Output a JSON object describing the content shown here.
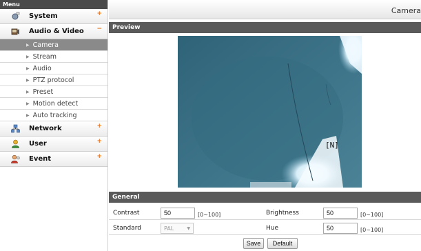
{
  "sidebar": {
    "header": "Menu",
    "sections": [
      {
        "label": "System",
        "mark": "+",
        "icon": "system-icon"
      },
      {
        "label": "Audio & Video",
        "mark": "−",
        "icon": "audio-video-icon"
      }
    ],
    "subitems": [
      {
        "label": "Camera"
      },
      {
        "label": "Stream"
      },
      {
        "label": "Audio"
      },
      {
        "label": "PTZ protocol"
      },
      {
        "label": "Preset"
      },
      {
        "label": "Motion detect"
      },
      {
        "label": "Auto tracking"
      }
    ],
    "sections_after": [
      {
        "label": "Network",
        "mark": "+",
        "icon": "network-icon"
      },
      {
        "label": "User",
        "mark": "+",
        "icon": "user-icon"
      },
      {
        "label": "Event",
        "mark": "+",
        "icon": "event-icon"
      }
    ],
    "active_subitem": "Camera"
  },
  "page": {
    "title": "Camera"
  },
  "preview": {
    "header": "Preview",
    "overlay_text": "[N]"
  },
  "general": {
    "header": "General",
    "contrast_label": "Contrast",
    "contrast_value": "50",
    "contrast_range": "[0~100]",
    "brightness_label": "Brightness",
    "brightness_value": "50",
    "brightness_range": "[0~100]",
    "standard_label": "Standard",
    "standard_value": "PAL",
    "hue_label": "Hue",
    "hue_value": "50",
    "hue_range": "[0~100]",
    "save_label": "Save",
    "default_label": "Default"
  },
  "colors": {
    "accent_mark": "#e8731a",
    "header_bar": "#5a5a5a",
    "active_item": "#8a8a8a"
  }
}
